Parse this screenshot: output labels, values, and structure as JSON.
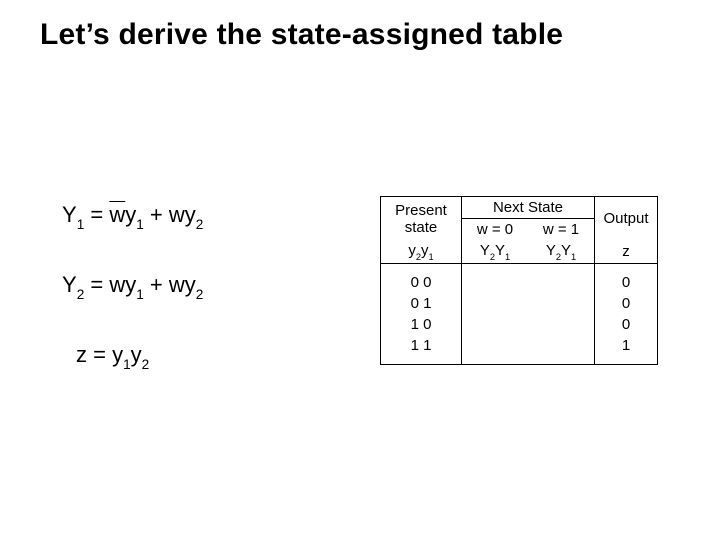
{
  "title": "Let’s derive the state-assigned table",
  "eq": {
    "Y1_lhs": "Y",
    "Y1_sub": "1",
    "eqsign": " = ",
    "w": "w",
    "y": "y",
    "plus": " + ",
    "Y2_lhs": "Y",
    "Y2_sub": "2",
    "z_lhs": "z",
    "one": "1",
    "two": "2"
  },
  "table": {
    "present_state_l1": "Present",
    "present_state_l2": "state",
    "next_state": "Next State",
    "w0": "w = 0",
    "w1": "w = 1",
    "output": "Output",
    "y2y1_y": "y",
    "Y2Y1_Y": "Y",
    "z": "z",
    "rows": [
      {
        "ps": "0 0",
        "z": "0"
      },
      {
        "ps": "0 1",
        "z": "0"
      },
      {
        "ps": "1 0",
        "z": "0"
      },
      {
        "ps": "1 1",
        "z": "1"
      }
    ]
  },
  "chart_data": {
    "type": "table",
    "title": "State-assigned table",
    "columns": [
      "y2y1",
      "Y2Y1 (w=0)",
      "Y2Y1 (w=1)",
      "z"
    ],
    "rows": [
      [
        "00",
        "",
        "",
        0
      ],
      [
        "01",
        "",
        "",
        0
      ],
      [
        "10",
        "",
        "",
        0
      ],
      [
        "11",
        "",
        "",
        1
      ]
    ],
    "equations": [
      "Y1 = (not w)·y1 + w·y2",
      "Y2 = w·y1 + w·y2",
      "z  = y1·y2"
    ]
  }
}
